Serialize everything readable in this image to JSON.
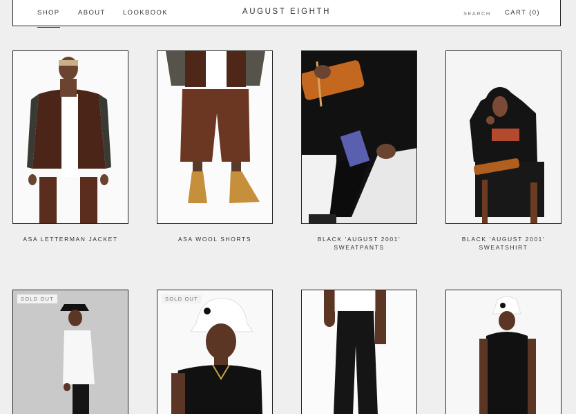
{
  "header": {
    "brand": "AUGUST EIGHTH",
    "nav": {
      "shop": "SHOP",
      "about": "ABOUT",
      "lookbook": "LOOKBOOK"
    },
    "search": "SEARCH",
    "cart": "CART (0)"
  },
  "products": [
    {
      "name": "ASA LETTERMAN JACKET"
    },
    {
      "name": "ASA WOOL SHORTS"
    },
    {
      "name": "BLACK 'AUGUST 2001'\nSWEATPANTS"
    },
    {
      "name": "BLACK 'AUGUST 2001'\nSWEATSHIRT"
    },
    {
      "badge": "SOLD OUT"
    },
    {
      "badge": "SOLD OUT"
    },
    {},
    {}
  ]
}
